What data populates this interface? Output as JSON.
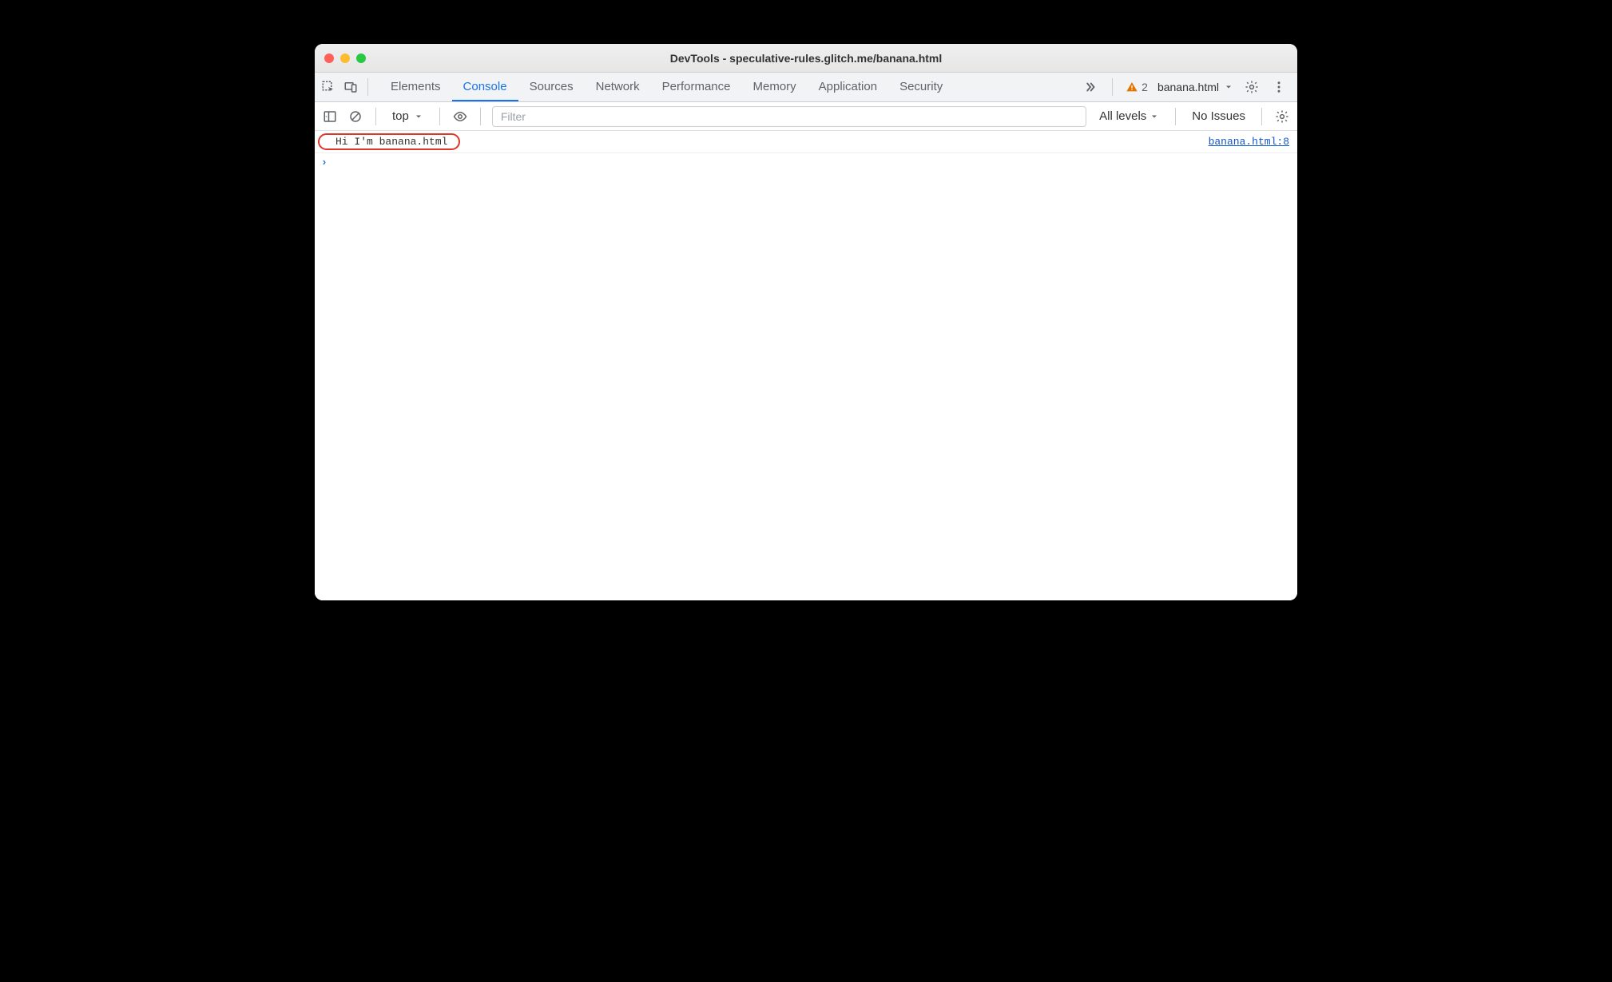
{
  "window": {
    "title": "DevTools - speculative-rules.glitch.me/banana.html"
  },
  "tabs": {
    "panels": [
      "Elements",
      "Console",
      "Sources",
      "Network",
      "Performance",
      "Memory",
      "Application",
      "Security"
    ],
    "active_index": 1,
    "warning_count": "2",
    "target_label": "banana.html"
  },
  "toolbar": {
    "context_label": "top",
    "filter_placeholder": "Filter",
    "levels_label": "All levels",
    "issues_label": "No Issues"
  },
  "console": {
    "rows": [
      {
        "message": "Hi I'm banana.html",
        "source": "banana.html:8",
        "highlighted": true
      }
    ]
  }
}
